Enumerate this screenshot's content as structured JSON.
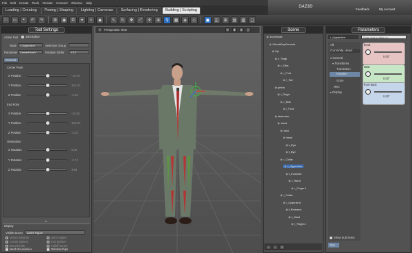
{
  "menu": [
    "File",
    "Edit",
    "Create",
    "Tools",
    "Render",
    "Connect",
    "Window",
    "Help"
  ],
  "brand": {
    "logo": "DAZ",
    "logo_sup": "3D",
    "links": [
      "Feedback",
      "My Account"
    ]
  },
  "tabs": [
    {
      "label": "Loading | Creating"
    },
    {
      "label": "Posing | Shaping"
    },
    {
      "label": "Lighting | Cameras"
    },
    {
      "label": "Surfacing | Rendering"
    },
    {
      "label": "Building | Scripting",
      "active": true
    }
  ],
  "tool_settings": {
    "title": "Tool Settings",
    "active_tool": "Active Tool",
    "joint_editor": "Joint Editor",
    "node_label": "Node",
    "node_value": "r_UpperArm",
    "sel_group_label": "Selection Group",
    "param_label": "Parameter",
    "param_value": "CenterPointY",
    "rot_order_label": "Rotation Order",
    "rot_order_value": "XYZ",
    "general_tab": "General",
    "center_point": "Center Point",
    "end_point": "End Point",
    "orientation": "Orientation",
    "center": [
      {
        "label": "X Position",
        "value": "-14.75"
      },
      {
        "label": "Y Position",
        "value": "142.40"
      },
      {
        "label": "Z Position",
        "value": "-2.40"
      }
    ],
    "end": [
      {
        "label": "X Position",
        "value": "-43.15"
      },
      {
        "label": "Y Position",
        "value": "140.50"
      },
      {
        "label": "Z Position",
        "value": "-3.20"
      }
    ],
    "orient": [
      {
        "label": "X Rotation",
        "value": "0.00"
      },
      {
        "label": "Y Rotation",
        "value": "-3.71"
      },
      {
        "label": "Z Rotation",
        "value": "3.85"
      }
    ],
    "display": "Display",
    "visible_bones": "Visible Bones",
    "visible_value": "Active Figure",
    "options": [
      {
        "label": "Vertex Weights",
        "on": false
      },
      {
        "label": "Joint Angles",
        "on": false
      },
      {
        "label": "Center Sphere",
        "on": false
      },
      {
        "label": "End Sphere",
        "on": false
      },
      {
        "label": "Bend Limits",
        "on": false
      },
      {
        "label": "Falloff Zones",
        "on": false
      },
      {
        "label": "Mesh Boundaries",
        "on": true
      },
      {
        "label": "Relationships",
        "on": true
      },
      {
        "label": "Bone Ghosting",
        "on": true
      },
      {
        "label": "Manipulators",
        "on": true
      }
    ]
  },
  "viewport": {
    "label": "Perspective View"
  },
  "scene": {
    "title": "Scene",
    "items": [
      "BoneNode",
      "VirtualGuyGenesis",
      "hip",
      "r_Thigh",
      "r_Shin",
      "r_Foot",
      "r_Toe",
      "pelvis",
      "l_Thigh",
      "l_Shin",
      "l_Foot",
      "abdomen",
      "chest",
      "neck",
      "head",
      "r_Eye",
      "l_Eye",
      "r_Collar",
      "r_UpperArm",
      "r_Forearm",
      "r_Hand",
      "r_Finger1",
      "l_Collar",
      "l_UpperArm",
      "l_Forearm",
      "l_Hand",
      "l_Finger1"
    ],
    "selected": "r_UpperArm"
  },
  "parameters": {
    "title": "Parameters",
    "node": "r_UpperArm",
    "filter_placeholder": "Enter text to filter by...",
    "categories": [
      "All",
      "Currently Used",
      "General",
      "Transforms",
      "Translation",
      "Rotation",
      "Scale",
      "Misc",
      "Display"
    ],
    "selected_category": "Rotation",
    "dials": [
      {
        "name": "bend",
        "value": "0.00°",
        "color": "#e8c6c6"
      },
      {
        "name": "twist",
        "value": "0.00°",
        "color": "#c8e8c8"
      },
      {
        "name": "front-back",
        "value": "0.00°",
        "color": "#c8d8ec"
      }
    ],
    "show_sub": "Show Sub Items",
    "tips": "Tips"
  }
}
